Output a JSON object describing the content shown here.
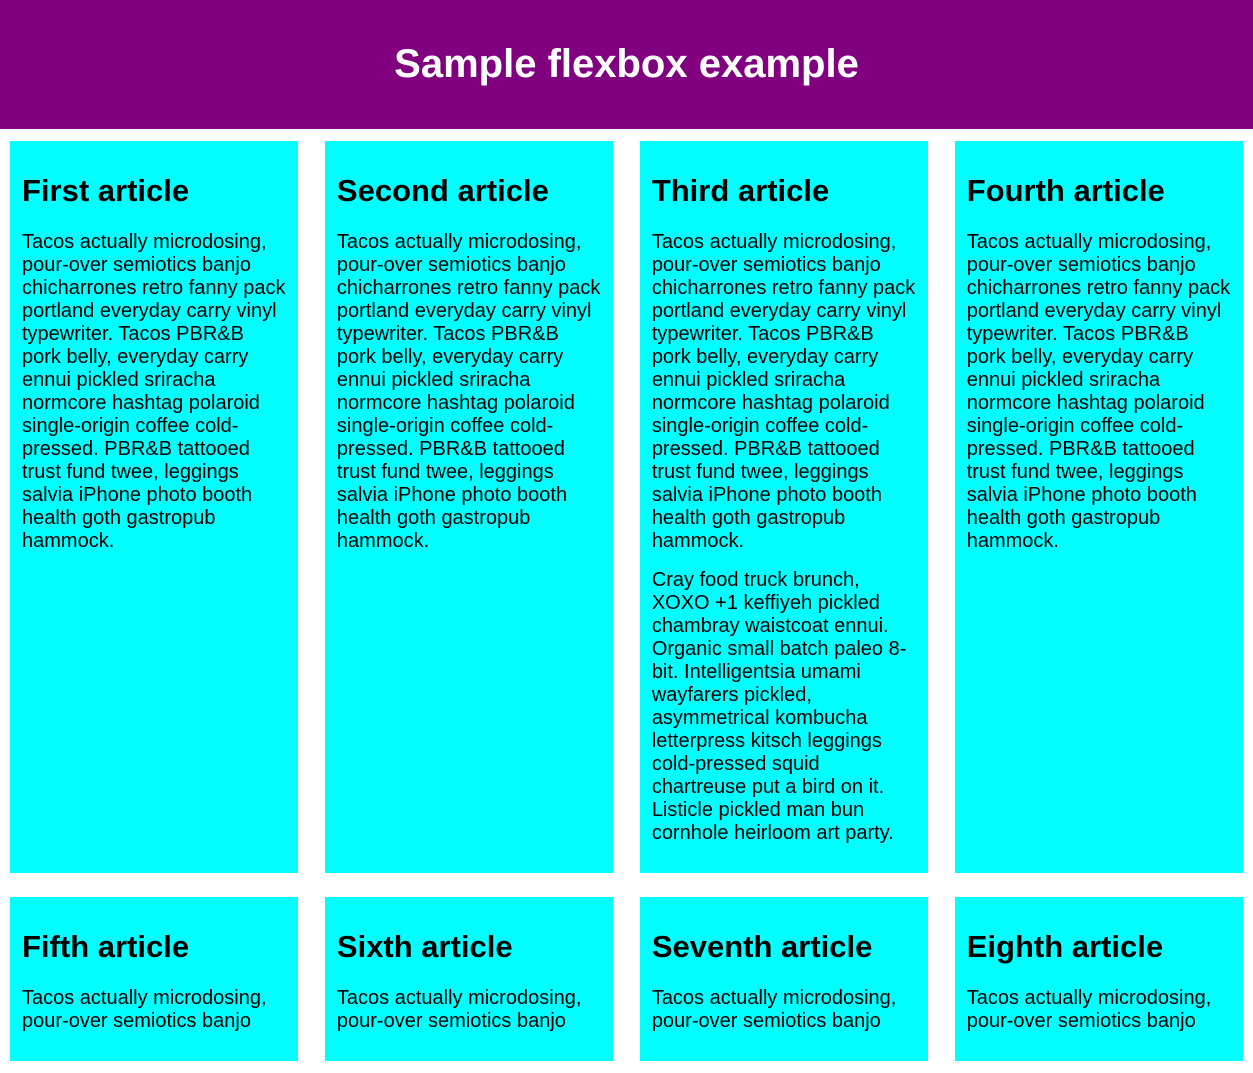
{
  "header": {
    "title": "Sample flexbox example"
  },
  "paragraph1": "Tacos actually microdosing, pour-over semiotics banjo chicharrones retro fanny pack portland everyday carry vinyl typewriter. Tacos PBR&B pork belly, everyday carry ennui pickled sriracha normcore hashtag polaroid single-origin coffee cold-pressed. PBR&B tattooed trust fund twee, leggings salvia iPhone photo booth health goth gastropub hammock.",
  "paragraph2": "Cray food truck brunch, XOXO +1 keffiyeh pickled chambray waistcoat ennui. Organic small batch paleo 8-bit. Intelligentsia umami wayfarers pickled, asymmetrical kombucha letterpress kitsch leggings cold-pressed squid chartreuse put a bird on it. Listicle pickled man bun cornhole heirloom art party.",
  "paragraph_partial": "Tacos actually microdosing, pour-over semiotics banjo",
  "articles": [
    {
      "title": "First article"
    },
    {
      "title": "Second article"
    },
    {
      "title": "Third article"
    },
    {
      "title": "Fourth article"
    },
    {
      "title": "Fifth article"
    },
    {
      "title": "Sixth article"
    },
    {
      "title": "Seventh article"
    },
    {
      "title": "Eighth article"
    }
  ]
}
